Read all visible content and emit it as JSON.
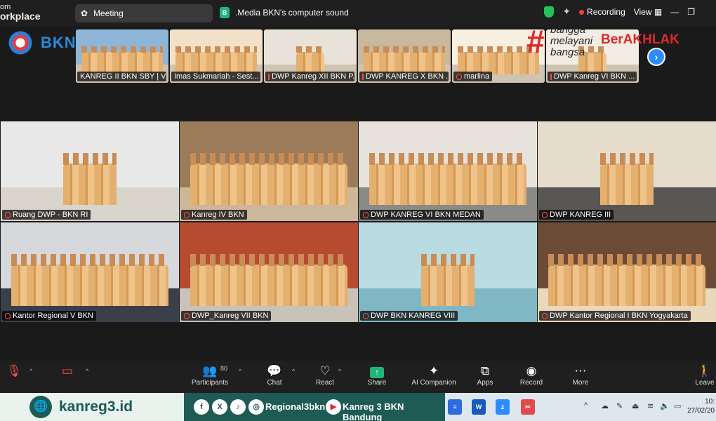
{
  "topbar": {
    "brand_line1": "om",
    "brand_line2": "orkplace",
    "meeting_label": "Meeting",
    "share_chip_letter": "B",
    "share_label": ".Media BKN's computer sound",
    "recording_label": "Recording",
    "view_label": "View"
  },
  "overlay": {
    "logo_text": "BKN",
    "tag_hash": "#",
    "tag_w1": "bangga",
    "tag_w2": "melayani",
    "tag_w3": "bangsa",
    "tag_big": "BerAKHLAK"
  },
  "strip": [
    {
      "label": "KANREG II BKN SBY | V...",
      "bg": "#8fb6d8",
      "mic_off": false
    },
    {
      "label": "Imas Sukmariah - Sest...",
      "bg": "#f3e0c9",
      "mic_off": false
    },
    {
      "label": "DWP Kanreg XII BKN P...",
      "bg": "#e9e2d8",
      "mic_off": true
    },
    {
      "label": "DWP KANREG X BKN ...",
      "bg": "#c7b89e",
      "mic_off": true
    },
    {
      "label": "marlina",
      "bg": "#f7efe0",
      "mic_off": true
    },
    {
      "label": "DWP Kanreg VI BKN ...",
      "bg": "#f2ece3",
      "mic_off": true
    }
  ],
  "tiles": [
    {
      "label": "Ruang DWP - BKN RI",
      "bg": "#e8e8e8",
      "floor": "#d9d4cc"
    },
    {
      "label": "Kanreg IV BKN",
      "bg": "#9b7b5a",
      "floor": "#cbb79a"
    },
    {
      "label": "DWP KANREG VI BKN MEDAN",
      "bg": "#e7e3dc",
      "floor": "#8a8a86"
    },
    {
      "label": "DWP KANREG III",
      "bg": "#e6dccb",
      "floor": "#5a5654"
    },
    {
      "label": "Kantor Regional V BKN",
      "bg": "#d6d8dc",
      "floor": "#3a3f4a"
    },
    {
      "label": "DWP_Kanreg VII BKN",
      "bg": "#b64b2f",
      "floor": "#c9c2b8"
    },
    {
      "label": "DWP BKN KANREG VIII",
      "bg": "#b9dbe2",
      "floor": "#7fb8c4"
    },
    {
      "label": "DWP Kantor Regional I BKN Yogyakarta",
      "bg": "#6b4a36",
      "floor": "#e9d9bc"
    }
  ],
  "toolbar": {
    "participants_label": "Participants",
    "participants_count": "80",
    "chat_label": "Chat",
    "react_label": "React",
    "share_label": "Share",
    "ai_label": "AI Companion",
    "apps_label": "Apps",
    "record_label": "Record",
    "more_label": "More",
    "leave_label": "Leave"
  },
  "banner": {
    "site": "kanreg3.id",
    "handle": "Regional3bkn",
    "channel": "Kanreg 3 BKN Bandung"
  },
  "taskbar": {
    "time": "10:",
    "date": "27/02/20"
  }
}
